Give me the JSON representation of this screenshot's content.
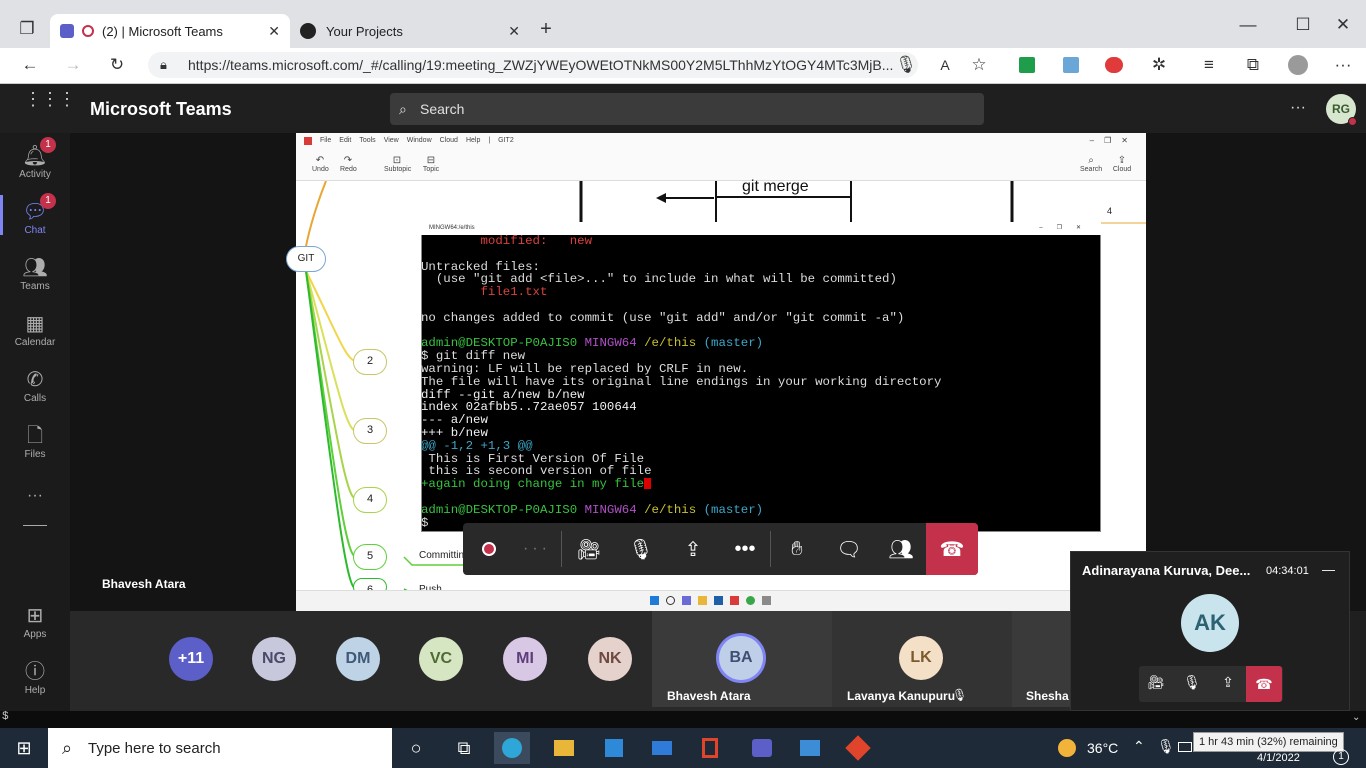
{
  "browser": {
    "tabs": [
      {
        "label": "(2) | Microsoft Teams"
      },
      {
        "label": "Your Projects"
      }
    ],
    "url": "https://teams.microsoft.com/_#/calling/19:meeting_ZWZjYWEyOWEtOTNkMS00Y2M5LThhMzYtOGY4MTc3MjB...",
    "new_tab": "+",
    "window_controls": [
      "—",
      "☐",
      "✕"
    ]
  },
  "teams": {
    "app_title": "Microsoft Teams",
    "search_placeholder": "Search",
    "user_initials": "RG",
    "more": "···",
    "rail": [
      {
        "label": "Activity",
        "badge": "1"
      },
      {
        "label": "Chat",
        "badge": "1"
      },
      {
        "label": "Teams"
      },
      {
        "label": "Calendar"
      },
      {
        "label": "Calls"
      },
      {
        "label": "Files"
      },
      {
        "label": "···"
      }
    ],
    "rail_bottom": [
      {
        "label": "Apps"
      },
      {
        "label": "Help"
      }
    ],
    "presenter_name": "Bhavesh Atara"
  },
  "xmind": {
    "menu": [
      "File",
      "Edit",
      "Tools",
      "View",
      "Window",
      "Cloud",
      "Help",
      "|",
      "GIT2"
    ],
    "tools": [
      "Undo",
      "Redo",
      "Subtopic",
      "Topic"
    ],
    "right_tools": [
      "Search",
      "Cloud"
    ],
    "diagram_label": "git merge",
    "root": "GIT",
    "nodes": [
      "2",
      "3",
      "4",
      "5",
      "6"
    ],
    "side_number": "4",
    "branch_texts": [
      "Committin",
      "Push"
    ]
  },
  "terminal": {
    "title": "MINGW64:/e/this",
    "lines": [
      {
        "t": "        modified:   new",
        "c": "c-red"
      },
      {
        "t": "",
        "c": ""
      },
      {
        "t": "Untracked files:",
        "c": ""
      },
      {
        "t": "  (use \"git add <file>...\" to include in what will be committed)",
        "c": ""
      },
      {
        "t": "        file1.txt",
        "c": "c-red"
      },
      {
        "t": "",
        "c": ""
      },
      {
        "t": "no changes added to commit (use \"git add\" and/or \"git commit -a\")",
        "c": ""
      },
      {
        "t": "",
        "c": ""
      },
      {
        "t": "admin@DESKTOP-P0AJIS0 MINGW64 /e/this (master)",
        "c": "prompt"
      },
      {
        "t": "$ git diff new",
        "c": ""
      },
      {
        "t": "warning: LF will be replaced by CRLF in new.",
        "c": ""
      },
      {
        "t": "The file will have its original line endings in your working directory",
        "c": ""
      },
      {
        "t": "diff --git a/new b/new",
        "c": "c-wht"
      },
      {
        "t": "index 02afbb5..72ae057 100644",
        "c": "c-wht"
      },
      {
        "t": "--- a/new",
        "c": "c-wht"
      },
      {
        "t": "+++ b/new",
        "c": "c-wht"
      },
      {
        "t": "@@ -1,2 +1,3 @@",
        "c": "c-cyan"
      },
      {
        "t": " This is First Version Of File",
        "c": ""
      },
      {
        "t": " this is second version of file",
        "c": ""
      },
      {
        "t": "+again doing change in my file",
        "c": "c-green"
      },
      {
        "t": "",
        "c": ""
      },
      {
        "t": "admin@DESKTOP-P0AJIS0 MINGW64 /e/this (master)",
        "c": "prompt"
      },
      {
        "t": "$",
        "c": ""
      }
    ]
  },
  "participants": [
    {
      "initials": "+11",
      "color": "#5b5fc7",
      "text": "#ffffff"
    },
    {
      "initials": "NG",
      "color": "#c8c8dc",
      "text": "#4a4a6a"
    },
    {
      "initials": "DM",
      "color": "#bfd3e6",
      "text": "#3f5a78"
    },
    {
      "initials": "VC",
      "color": "#d6e6c3",
      "text": "#4e6b33"
    },
    {
      "initials": "MI",
      "color": "#d8c8e6",
      "text": "#5e3f7a"
    },
    {
      "initials": "NK",
      "color": "#e6d2cc",
      "text": "#6e4a40"
    }
  ],
  "tiles": [
    {
      "initials": "BA",
      "name": "Bhavesh Atara",
      "color": "#c0cfe8",
      "text": "#3e4f72"
    },
    {
      "initials": "LK",
      "name": "Lavanya Kanupuru",
      "color": "#f3e0c6",
      "text": "#7a5a2e"
    },
    {
      "name": "Shesha T"
    }
  ],
  "mini_call": {
    "title": "Adinarayana Kuruva, Dee...",
    "timer": "04:34:01",
    "initials": "AK"
  },
  "taskbar": {
    "search_placeholder": "Type here to search",
    "temperature": "36°C",
    "battery_tooltip": "1 hr 43 min (32%) remaining",
    "date": "4/1/2022"
  }
}
